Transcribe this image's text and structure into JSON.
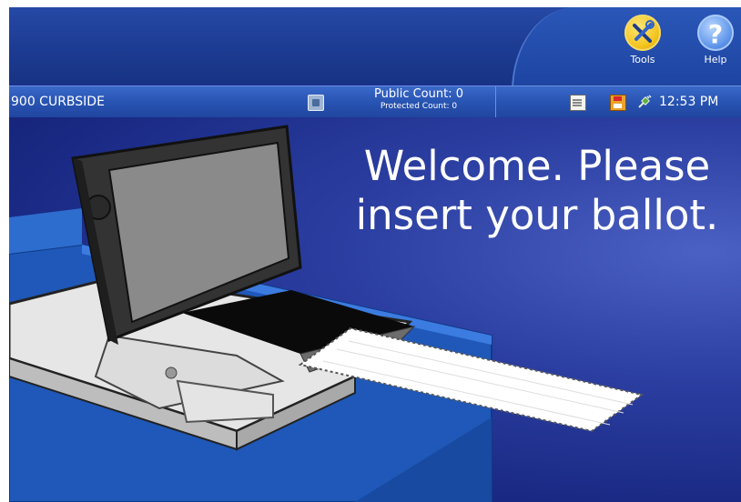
{
  "header": {
    "tools_label": "Tools",
    "help_label": "Help",
    "help_glyph": "?"
  },
  "status_bar": {
    "poll_name": "900 CURBSIDE",
    "public_count": "Public Count: 0",
    "protected_count": "Protected Count: 0",
    "time": "12:53 PM"
  },
  "main": {
    "welcome_line1": "Welcome. Please",
    "welcome_line2": "insert your ballot."
  },
  "icons": {
    "tools": "tools-icon",
    "help": "help-icon",
    "screen": "screen-icon",
    "document": "document-icon",
    "disk": "disk-icon",
    "plug": "plug-icon"
  },
  "colors": {
    "background": "#1a2f8e",
    "status_bar": "#2854b3",
    "tools_accent": "#f2c41c",
    "help_accent": "#5f96ea"
  }
}
